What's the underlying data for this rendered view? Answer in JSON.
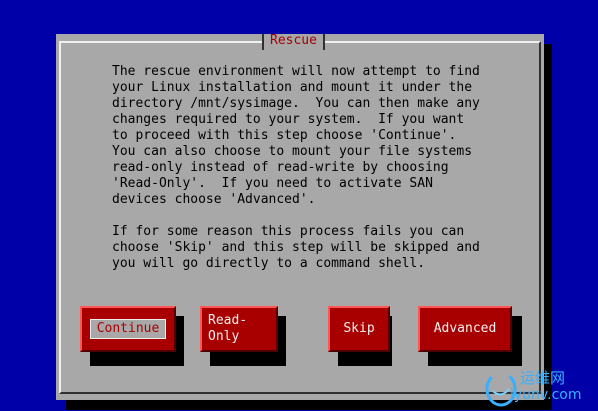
{
  "dialog": {
    "title": "Rescue",
    "message": "The rescue environment will now attempt to find\nyour Linux installation and mount it under the\ndirectory /mnt/sysimage.  You can then make any\nchanges required to your system.  If you want\nto proceed with this step choose 'Continue'.\nYou can also choose to mount your file systems\nread-only instead of read-write by choosing\n'Read-Only'.  If you need to activate SAN\ndevices choose 'Advanced'.\n\nIf for some reason this process fails you can\nchoose 'Skip' and this step will be skipped and\nyou will go directly to a command shell.",
    "buttons": {
      "continue": "Continue",
      "readonly": "Read-Only",
      "skip": "Skip",
      "advanced": "Advanced"
    }
  },
  "watermark": {
    "name": "运维网",
    "url": "iyunv.com"
  },
  "colors": {
    "background": "#0000a8",
    "dialog": "#a8a8a8",
    "button": "#a80000",
    "title": "#a80000"
  }
}
